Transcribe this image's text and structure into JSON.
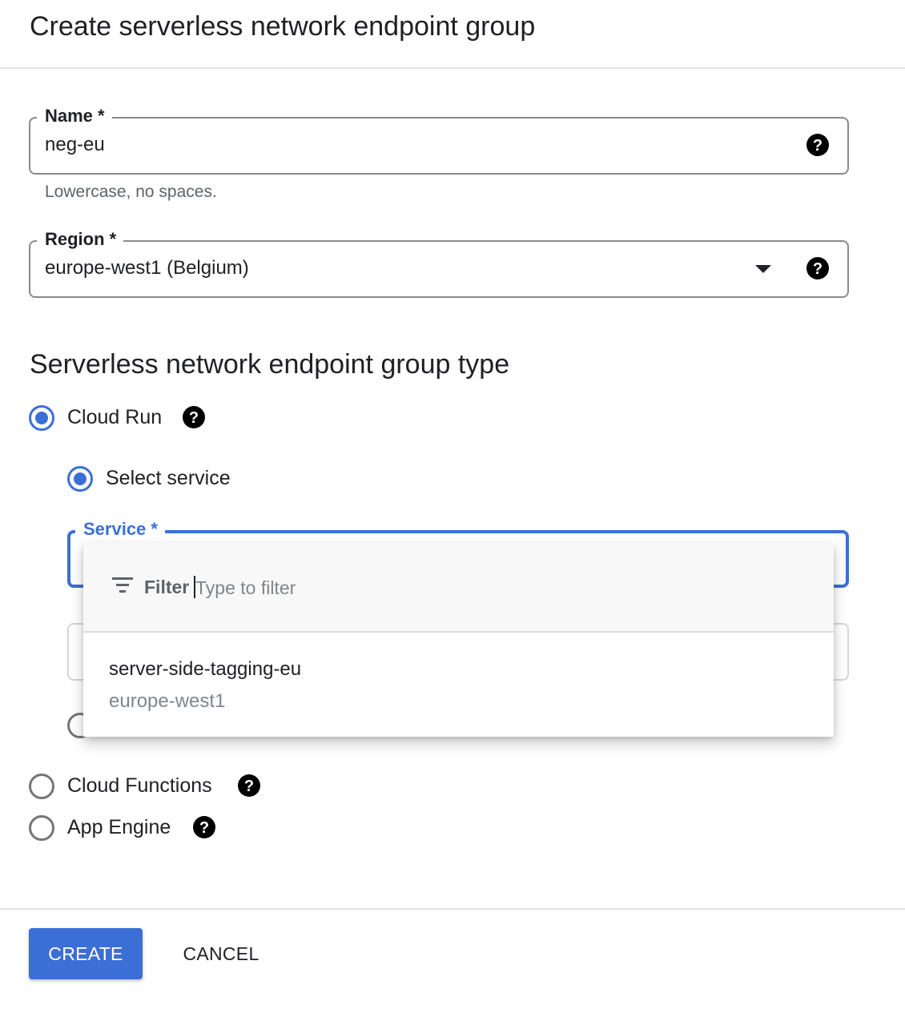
{
  "header": {
    "title": "Create serverless network endpoint group"
  },
  "name_field": {
    "label": "Name *",
    "value": "neg-eu",
    "hint": "Lowercase, no spaces.",
    "help_icon": "help-circle-icon"
  },
  "region_field": {
    "label": "Region *",
    "value": "europe-west1 (Belgium)",
    "dropdown_icon": "arrow-drop-down-icon",
    "help_icon": "help-circle-icon"
  },
  "neg_type": {
    "heading": "Serverless network endpoint group type",
    "options": [
      {
        "label": "Cloud Run",
        "selected": true
      },
      {
        "label": "Cloud Functions",
        "selected": false
      },
      {
        "label": "App Engine",
        "selected": false
      }
    ]
  },
  "cloud_run": {
    "select_service_label": "Select service",
    "service_field_label": "Service *",
    "dropdown": {
      "filter_label": "Filter",
      "filter_placeholder": "Type to filter",
      "filter_icon": "filter-list-icon",
      "items": [
        {
          "name": "server-side-tagging-eu",
          "region": "europe-west1"
        }
      ]
    }
  },
  "footer": {
    "create_label": "CREATE",
    "cancel_label": "CANCEL"
  },
  "colors": {
    "accent": "#3c6fd6",
    "text": "#202124",
    "muted": "#5f6368"
  }
}
